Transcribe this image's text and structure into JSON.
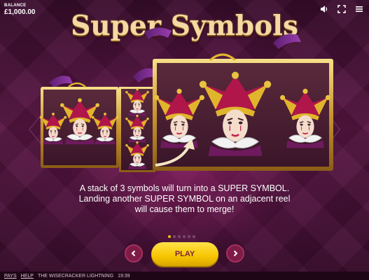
{
  "balance": {
    "label": "BALANCE",
    "value": "£1,000.00"
  },
  "top_icons": [
    "speaker-icon",
    "fullscreen-icon",
    "menu-icon"
  ],
  "title": "Super Symbols",
  "description": {
    "line1": "A stack of 3 symbols will turn into a SUPER SYMBOL.",
    "line2": "Landing another SUPER SYMBOL on an adjacent reel",
    "line3": "will cause them to merge!"
  },
  "pagination": {
    "total": 6,
    "current": 1
  },
  "buttons": {
    "play": "PLAY",
    "prev_icon": "chevron-left-icon",
    "next_icon": "chevron-right-icon"
  },
  "footer": {
    "pays": "PAYS",
    "help": "HELP",
    "game_name": "THE WISECRACKER LIGHTNING",
    "time": "19:39"
  },
  "colors": {
    "accent": "#f7c500",
    "background": "#3a0f2c",
    "nav_button": "#7e1b46",
    "play_text": "#7a1f3a"
  }
}
